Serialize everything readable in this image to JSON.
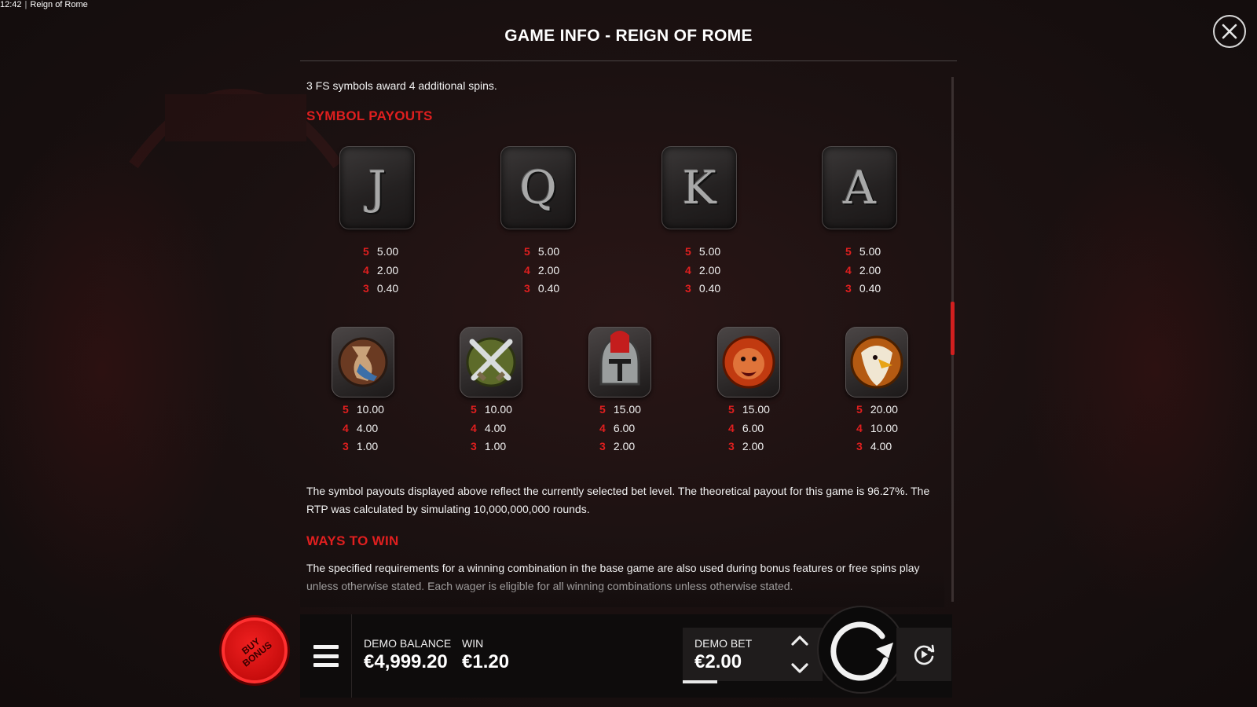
{
  "status_bar": {
    "time": "12:42",
    "app_title": "Reign of Rome"
  },
  "window_title": "GAME INFO - REIGN OF ROME",
  "intro_text": "3 FS symbols award 4 additional spins.",
  "sections": {
    "symbol_payouts_heading": "SYMBOL PAYOUTS",
    "ways_to_win_heading": "WAYS TO WIN"
  },
  "card_symbols": [
    {
      "glyph": "J",
      "icon": "jack-card-icon",
      "pays": [
        {
          "count": "5",
          "value": "5.00"
        },
        {
          "count": "4",
          "value": "2.00"
        },
        {
          "count": "3",
          "value": "0.40"
        }
      ]
    },
    {
      "glyph": "Q",
      "icon": "queen-card-icon",
      "pays": [
        {
          "count": "5",
          "value": "5.00"
        },
        {
          "count": "4",
          "value": "2.00"
        },
        {
          "count": "3",
          "value": "0.40"
        }
      ]
    },
    {
      "glyph": "K",
      "icon": "king-card-icon",
      "pays": [
        {
          "count": "5",
          "value": "5.00"
        },
        {
          "count": "4",
          "value": "2.00"
        },
        {
          "count": "3",
          "value": "0.40"
        }
      ]
    },
    {
      "glyph": "A",
      "icon": "ace-card-icon",
      "pays": [
        {
          "count": "5",
          "value": "5.00"
        },
        {
          "count": "4",
          "value": "2.00"
        },
        {
          "count": "3",
          "value": "0.40"
        }
      ]
    }
  ],
  "premium_symbols": [
    {
      "icon": "horn-icon",
      "pays": [
        {
          "count": "5",
          "value": "10.00"
        },
        {
          "count": "4",
          "value": "4.00"
        },
        {
          "count": "3",
          "value": "1.00"
        }
      ]
    },
    {
      "icon": "crossed-swords-icon",
      "pays": [
        {
          "count": "5",
          "value": "10.00"
        },
        {
          "count": "4",
          "value": "4.00"
        },
        {
          "count": "3",
          "value": "1.00"
        }
      ]
    },
    {
      "icon": "gladiator-helmet-icon",
      "pays": [
        {
          "count": "5",
          "value": "15.00"
        },
        {
          "count": "4",
          "value": "6.00"
        },
        {
          "count": "3",
          "value": "2.00"
        }
      ]
    },
    {
      "icon": "lion-icon",
      "pays": [
        {
          "count": "5",
          "value": "15.00"
        },
        {
          "count": "4",
          "value": "6.00"
        },
        {
          "count": "3",
          "value": "2.00"
        }
      ]
    },
    {
      "icon": "eagle-icon",
      "pays": [
        {
          "count": "5",
          "value": "20.00"
        },
        {
          "count": "4",
          "value": "10.00"
        },
        {
          "count": "3",
          "value": "4.00"
        }
      ]
    }
  ],
  "rtp_text_line1": "The symbol payouts displayed above reflect the currently selected bet level. The theoretical payout for this game is 96.27%. The",
  "rtp_text_line2": "RTP was calculated by simulating 10,000,000,000 rounds.",
  "ways_text_line1": "The specified requirements for a winning combination in the base game are also used during bonus features or free spins play",
  "ways_text_line2": "unless otherwise stated. Each wager is eligible for all winning combinations unless otherwise stated.",
  "bottom_bar": {
    "buy_bonus_label": "BUY\nBONUS",
    "balance_label": "DEMO BALANCE",
    "balance_value": "€4,999.20",
    "win_label": "WIN",
    "win_value": "€1.20",
    "bet_label": "DEMO BET",
    "bet_value": "€2.00"
  },
  "colors": {
    "accent_red": "#e01f1f",
    "text": "#f1f1f1",
    "background": "#141010"
  }
}
